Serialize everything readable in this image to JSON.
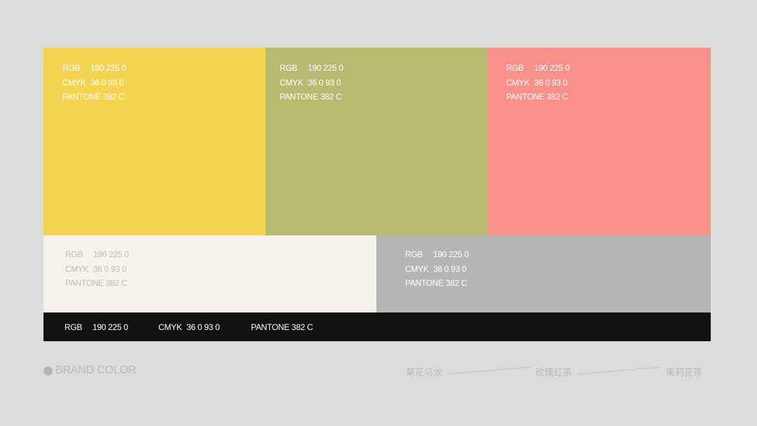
{
  "colors": {
    "background": "#dcdcda",
    "footer_text": "#b9b9b7"
  },
  "swatches_top": [
    {
      "name": "yellow",
      "color": "#f3d350",
      "text_color": "#ffffff",
      "rgb_label": "RGB",
      "rgb": "190 225 0",
      "cmyk_label": "CMYK",
      "cmyk": "36 0 93 0",
      "pantone": "PANTONE 382 C"
    },
    {
      "name": "olive",
      "color": "#b9ba72",
      "text_color": "#ffffff",
      "rgb_label": "RGB",
      "rgb": "190 225 0",
      "cmyk_label": "CMYK",
      "cmyk": "36 0 93 0",
      "pantone": "PANTONE 382 C"
    },
    {
      "name": "salmon",
      "color": "#f8918a",
      "text_color": "#ffffff",
      "rgb_label": "RGB",
      "rgb": "190 225 0",
      "cmyk_label": "CMYK",
      "cmyk": "36 0 93 0",
      "pantone": "PANTONE 382 C"
    }
  ],
  "swatches_middle": [
    {
      "name": "cream",
      "color": "#f6f2ec",
      "text_color": "#bdbdbb",
      "rgb_label": "RGB",
      "rgb": "190 225 0",
      "cmyk_label": "CMYK",
      "cmyk": "36 0 93 0",
      "pantone": "PANTONE 382 C"
    },
    {
      "name": "gray",
      "color": "#b5b5b5",
      "text_color": "#ffffff",
      "rgb_label": "RGB",
      "rgb": "190 225 0",
      "cmyk_label": "CMYK",
      "cmyk": "36 0 93 0",
      "pantone": "PANTONE 382 C"
    }
  ],
  "black_bar": {
    "color": "#121212",
    "text_color": "#ffffff",
    "rgb_label": "RGB",
    "rgb": "190 225 0",
    "cmyk_label": "CMYK",
    "cmyk": "36 0 93 0",
    "pantone": "PANTONE 382 C"
  },
  "footer": {
    "dot_color": "#b5b5b5",
    "brand_label": "BRAND COLOR",
    "teas": [
      "菊花乌龙",
      "玫瑰红茶",
      "茉莉花茶"
    ]
  }
}
